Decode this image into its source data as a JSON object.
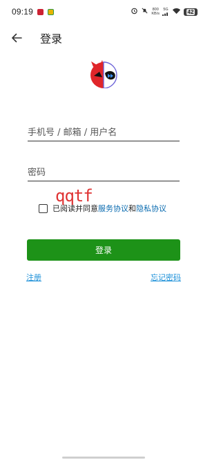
{
  "status_bar": {
    "time": "09:19",
    "net_speed_value": "800",
    "net_speed_unit": "KB/s",
    "signal_label": "5G",
    "battery_level": "42",
    "icons": [
      "alarm-icon",
      "mute-icon",
      "wifi-icon",
      "signal-icon"
    ]
  },
  "header": {
    "title": "登录",
    "back_icon": "arrow-left-icon"
  },
  "form": {
    "username_placeholder": "手机号 / 邮箱 / 用户名",
    "password_placeholder": "密码",
    "captcha_text": "qqtf",
    "agreement_prefix": "已阅读并同意",
    "terms_link": "服务协议",
    "agreement_and": "和",
    "privacy_link": "隐私协议",
    "login_label": "登录"
  },
  "footer": {
    "register_label": "注册",
    "forgot_label": "忘记密码"
  },
  "colors": {
    "accent_green": "#1d9218",
    "link_blue": "#1a8fd8",
    "captcha_red": "#dd2222"
  }
}
